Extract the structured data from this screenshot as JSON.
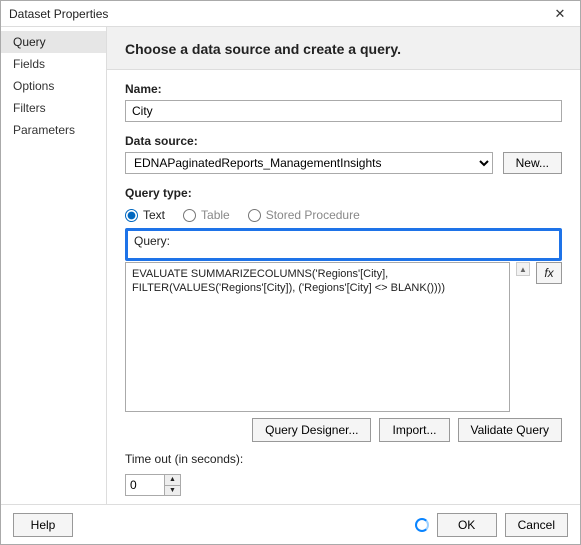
{
  "title": "Dataset Properties",
  "sidebar": {
    "items": [
      {
        "label": "Query"
      },
      {
        "label": "Fields"
      },
      {
        "label": "Options"
      },
      {
        "label": "Filters"
      },
      {
        "label": "Parameters"
      }
    ],
    "selected_index": 0
  },
  "header": {
    "text": "Choose a data source and create a query."
  },
  "name_field": {
    "label": "Name:",
    "value": "City"
  },
  "datasource": {
    "label": "Data source:",
    "value": "EDNAPaginatedReports_ManagementInsights",
    "new_button": "New..."
  },
  "query_type": {
    "label": "Query type:",
    "options": {
      "text": "Text",
      "table": "Table",
      "sproc": "Stored Procedure"
    },
    "selected": "text"
  },
  "query": {
    "label": "Query:",
    "text": "EVALUATE SUMMARIZECOLUMNS('Regions'[City], FILTER(VALUES('Regions'[City]), ('Regions'[City] <> BLANK())))",
    "fx_label": "fx",
    "buttons": {
      "designer": "Query Designer...",
      "import": "Import...",
      "validate": "Validate Query"
    }
  },
  "timeout": {
    "label": "Time out (in seconds):",
    "value": "0"
  },
  "footer": {
    "help": "Help",
    "ok": "OK",
    "cancel": "Cancel"
  }
}
